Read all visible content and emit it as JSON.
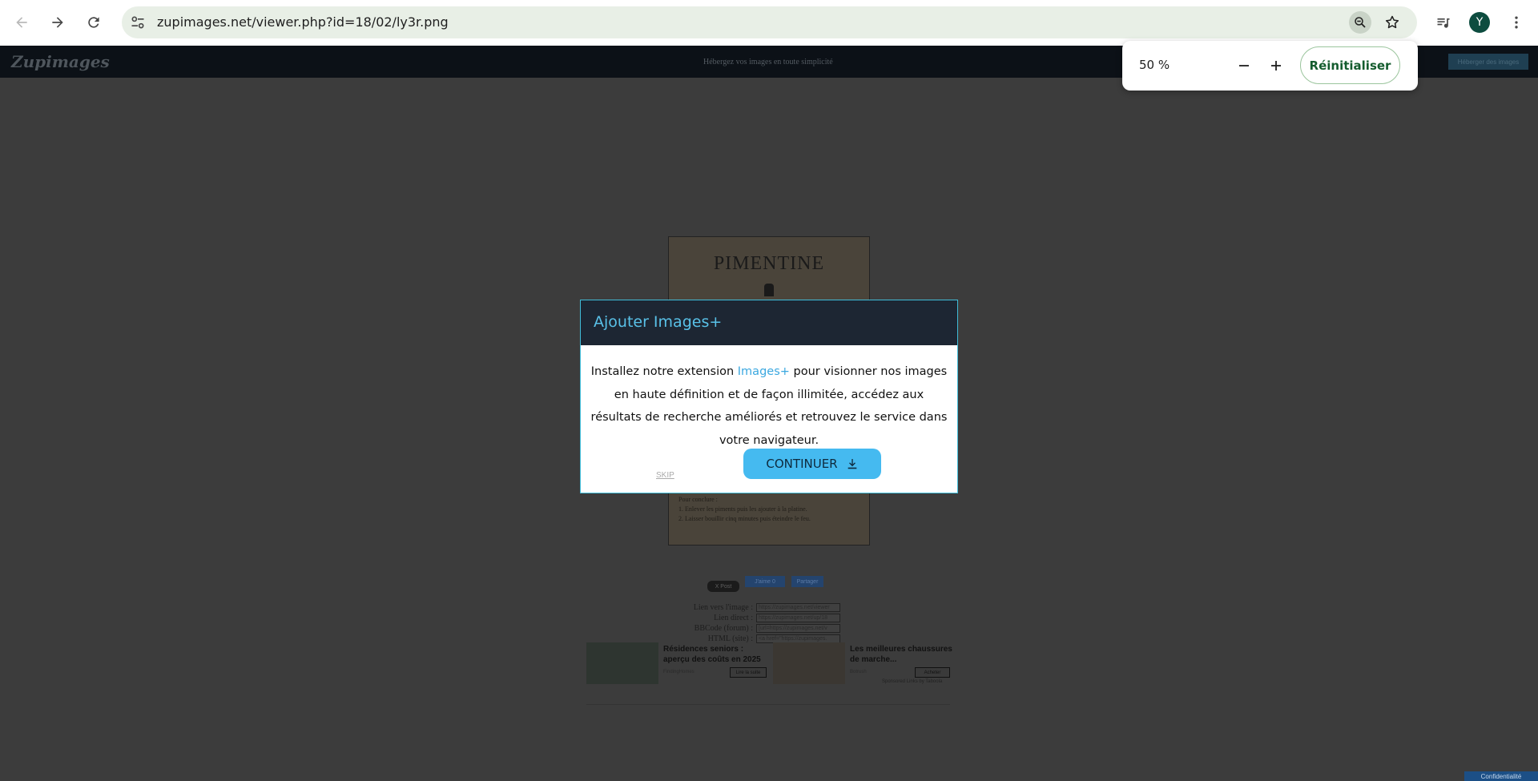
{
  "browser": {
    "url": "zupimages.net/viewer.php?id=18/02/ly3r.png",
    "avatar_initial": "Y"
  },
  "zoom_popup": {
    "level": "50 %",
    "reset_label": "Réinitialiser"
  },
  "site": {
    "logo": "Zupimages",
    "slogan": "Hébergez vos images en toute simplicité",
    "upload_button": "Héberger des images"
  },
  "document": {
    "title": "PIMENTINE",
    "lines": [
      "Pour conclure :",
      "1. Enlever les piments puis les ajouter à la platine.",
      "2. Laisser bouillir cinq minutes puis éteindre le feu."
    ]
  },
  "share": {
    "x_post": "X Post",
    "like": "J'aime 0",
    "share": "Partager"
  },
  "links": [
    {
      "label": "Lien vers l'image :",
      "value": "https://zupimages.net/viewer"
    },
    {
      "label": "Lien direct :",
      "value": "https://zupimages.net/up/18"
    },
    {
      "label": "BBCode (forum) :",
      "value": "[url=https://zupimages.net/v"
    },
    {
      "label": "HTML (site) :",
      "value": "<a href=\"https://zupimages."
    }
  ],
  "ads": [
    {
      "title": "Résidences seniors : aperçu des coûts en 2025",
      "source": "FindingHomes",
      "button": "Lire la suite"
    },
    {
      "title": "Les meilleures chaussures de marche...",
      "source": "Botrush",
      "button": "Acheter"
    }
  ],
  "ads_credit": "Sponsored Links by Taboola",
  "privacy_badge": "Confidentialité",
  "modal": {
    "title": "Ajouter Images+",
    "body_before": "Installez notre extension ",
    "body_link": "Images+",
    "body_after": " pour visionner nos images en haute définition et de façon illimitée, accédez aux résultats de recherche améliorés et retrouvez le service dans votre navigateur.",
    "skip_label": "SKIP",
    "continue_label": "CONTINUER"
  }
}
